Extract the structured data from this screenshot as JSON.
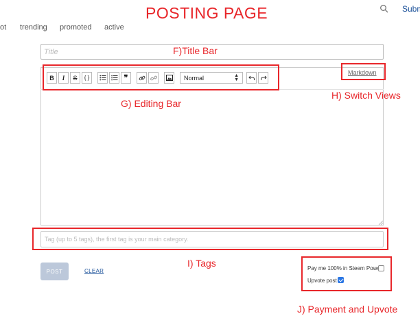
{
  "annotations": {
    "page_title": "POSTING PAGE",
    "title_bar": "F)Title Bar",
    "editing_bar": "G) Editing Bar",
    "switch_views": "H) Switch Views",
    "tags": "I) Tags",
    "payment_upvote": "J) Payment and Upvote"
  },
  "header": {
    "submit_label": "Subm"
  },
  "nav": {
    "items": [
      "ot",
      "trending",
      "promoted",
      "active"
    ]
  },
  "editor": {
    "title_placeholder": "Title",
    "toolbar": {
      "bold": "B",
      "italic": "I",
      "strike": "S",
      "code": "{ }",
      "quote": "❞",
      "heading_select": "Normal"
    },
    "markdown_label": "Markdown",
    "tags_placeholder": "Tag (up to 5 tags), the first tag is your main category."
  },
  "actions": {
    "post_label": "POST",
    "clear_label": "CLEAR"
  },
  "options": {
    "pay_label": "Pay me 100% in Steem Power",
    "pay_checked": false,
    "upvote_label": "Upvote post",
    "upvote_checked": true
  },
  "colors": {
    "annotation": "#e8262a",
    "link": "#1a5099",
    "post_button": "#bcc8da",
    "checkbox_checked": "#2b77e4"
  }
}
